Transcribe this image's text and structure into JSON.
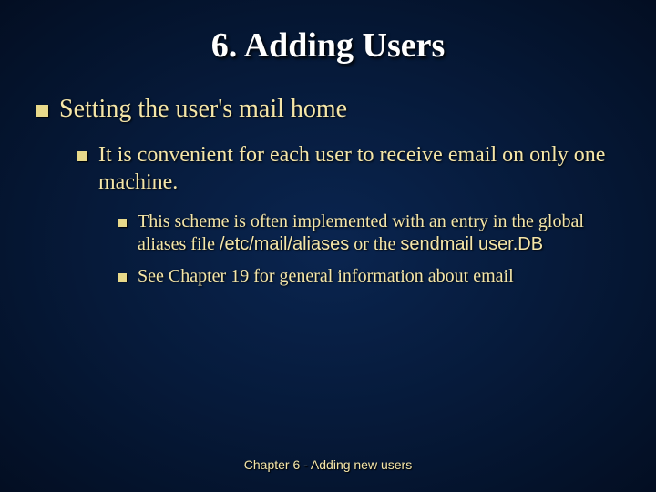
{
  "title": "6. Adding Users",
  "level1": {
    "text": "Setting the user's mail home"
  },
  "level2": {
    "text": "It is convenient for each user to receive email on only one machine."
  },
  "level3a": {
    "prefix": "This scheme is often implemented with an entry in the global aliases file ",
    "code1": "/etc/mail/aliases",
    "mid": " or the ",
    "code2": "sendmail user.DB"
  },
  "level3b": {
    "text": "See Chapter 19 for general information about email"
  },
  "footer": "Chapter 6 - Adding new users"
}
